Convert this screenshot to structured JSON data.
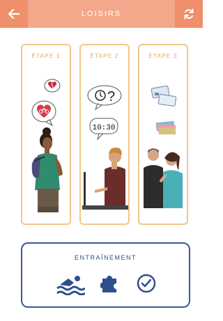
{
  "header": {
    "title": "LOISIRS",
    "back_icon": "arrow-left-icon",
    "refresh_icon": "refresh-icon",
    "color": "#ef8f6c"
  },
  "steps": [
    {
      "label": "ÉTAPE 1"
    },
    {
      "label": "ÉTAPE 2",
      "clock_text": "10:30",
      "question": "?"
    },
    {
      "label": "ÉTAPE 3"
    }
  ],
  "training": {
    "label": "ENTRAÎNEMENT",
    "icons": [
      "swimmer-icon",
      "puzzle-icon",
      "check-circle-icon"
    ],
    "color": "#2f4f8c"
  },
  "colors": {
    "card_border": "#f3c58a",
    "card_label": "#e8a35a"
  }
}
